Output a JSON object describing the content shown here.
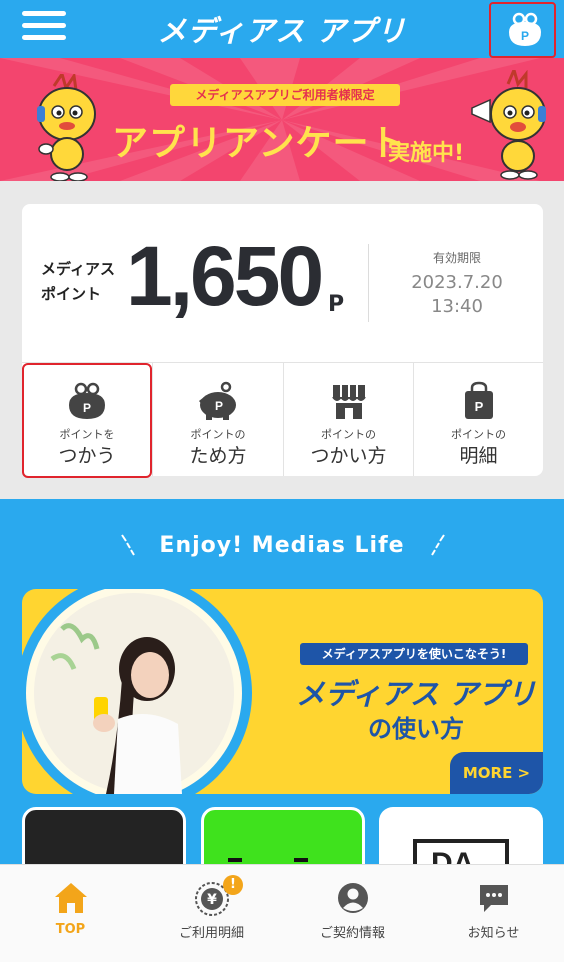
{
  "header": {
    "title": "メディアス アプリ"
  },
  "banner": {
    "badge": "メディアスアプリご利用者様限定",
    "title": "アプリアンケート",
    "sub": "実施中!"
  },
  "points": {
    "label_line1": "メディアス",
    "label_line2": "ポイント",
    "value": "1,650",
    "unit": "P",
    "expiry_label": "有効期限",
    "expiry_date": "2023.7.20",
    "expiry_time": "13:40"
  },
  "point_menu": [
    {
      "small": "ポイントを",
      "big": "つかう",
      "icon": "wallet-icon"
    },
    {
      "small": "ポイントの",
      "big": "ため方",
      "icon": "piggy-bank-icon"
    },
    {
      "small": "ポイントの",
      "big": "つかい方",
      "icon": "store-icon"
    },
    {
      "small": "ポイントの",
      "big": "明細",
      "icon": "shopping-bag-icon"
    }
  ],
  "enjoy": {
    "title": "Enjoy! Medias Life"
  },
  "howto": {
    "badge": "メディアスアプリを使いこなそう!",
    "title1": "メディアス アプリ",
    "title2": "の使い方",
    "more": "MORE >"
  },
  "thumbnails": {
    "third_text": "DA"
  },
  "bottom_nav": [
    {
      "label": "TOP",
      "icon": "home-icon",
      "active": true
    },
    {
      "label": "ご利用明細",
      "icon": "yen-coin-icon",
      "badge": "!"
    },
    {
      "label": "ご契約情報",
      "icon": "user-icon"
    },
    {
      "label": "お知らせ",
      "icon": "chat-bubble-icon"
    }
  ],
  "colors": {
    "header": "#2aa9ee",
    "banner": "#f3456e",
    "accent_yellow": "#ffd530",
    "nav_active": "#f3a51a",
    "highlight": "#e0242d"
  }
}
